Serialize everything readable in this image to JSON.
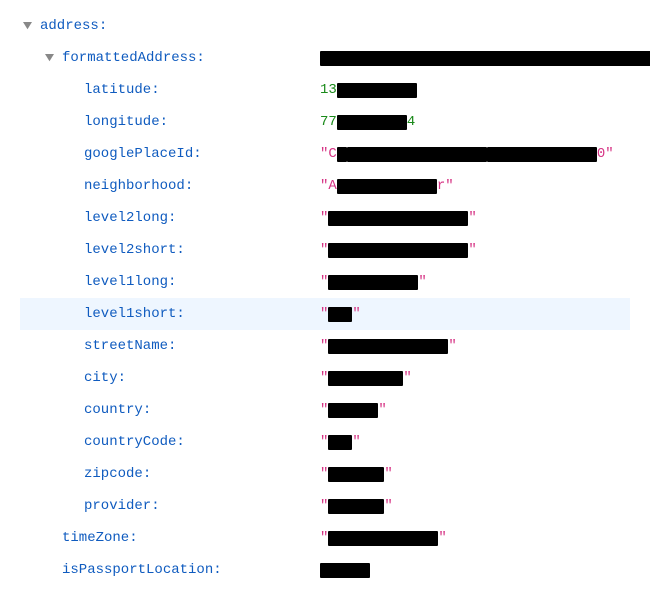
{
  "rows": [
    {
      "indent": 0,
      "toggle": true,
      "key": "address",
      "highlight": false,
      "value": {
        "type": "none"
      }
    },
    {
      "indent": 1,
      "toggle": true,
      "key": "formattedAddress",
      "highlight": false,
      "value": {
        "type": "redacted-plain",
        "parts": [
          {
            "redactW": 340
          }
        ]
      }
    },
    {
      "indent": 2,
      "toggle": false,
      "key": "latitude",
      "highlight": false,
      "value": {
        "type": "number-redacted",
        "parts": [
          {
            "text": "13"
          },
          {
            "redactW": 80
          }
        ]
      }
    },
    {
      "indent": 2,
      "toggle": false,
      "key": "longitude",
      "highlight": false,
      "value": {
        "type": "number-redacted",
        "parts": [
          {
            "text": "77"
          },
          {
            "redactW": 70
          },
          {
            "text": "4"
          }
        ]
      }
    },
    {
      "indent": 2,
      "toggle": false,
      "key": "googlePlaceId",
      "highlight": false,
      "value": {
        "type": "string-redacted",
        "parts": [
          {
            "text": "C"
          },
          {
            "redactW": 10
          },
          {
            "text": ""
          },
          {
            "redactW": 140
          },
          {
            "text": ""
          },
          {
            "redactW": 110
          },
          {
            "text": "0"
          }
        ]
      }
    },
    {
      "indent": 2,
      "toggle": false,
      "key": "neighborhood",
      "highlight": false,
      "value": {
        "type": "string-redacted",
        "parts": [
          {
            "text": "A"
          },
          {
            "redactW": 100
          },
          {
            "text": "r"
          }
        ]
      }
    },
    {
      "indent": 2,
      "toggle": false,
      "key": "level2long",
      "highlight": false,
      "value": {
        "type": "string-redacted",
        "parts": [
          {
            "text": ""
          },
          {
            "redactW": 140
          },
          {
            "text": ""
          }
        ]
      }
    },
    {
      "indent": 2,
      "toggle": false,
      "key": "level2short",
      "highlight": false,
      "value": {
        "type": "string-redacted",
        "parts": [
          {
            "text": ""
          },
          {
            "redactW": 140
          },
          {
            "text": ""
          }
        ]
      }
    },
    {
      "indent": 2,
      "toggle": false,
      "key": "level1long",
      "highlight": false,
      "value": {
        "type": "string-redacted",
        "parts": [
          {
            "text": ""
          },
          {
            "redactW": 90
          },
          {
            "text": ""
          }
        ]
      }
    },
    {
      "indent": 2,
      "toggle": false,
      "key": "level1short",
      "highlight": true,
      "value": {
        "type": "string-redacted",
        "parts": [
          {
            "text": ""
          },
          {
            "redactW": 24
          },
          {
            "text": ""
          }
        ]
      }
    },
    {
      "indent": 2,
      "toggle": false,
      "key": "streetName",
      "highlight": false,
      "value": {
        "type": "string-redacted",
        "parts": [
          {
            "text": ""
          },
          {
            "redactW": 120
          },
          {
            "text": ""
          }
        ]
      }
    },
    {
      "indent": 2,
      "toggle": false,
      "key": "city",
      "highlight": false,
      "value": {
        "type": "string-redacted",
        "parts": [
          {
            "text": ""
          },
          {
            "redactW": 75
          },
          {
            "text": ""
          }
        ]
      }
    },
    {
      "indent": 2,
      "toggle": false,
      "key": "country",
      "highlight": false,
      "value": {
        "type": "string-redacted",
        "parts": [
          {
            "text": ""
          },
          {
            "redactW": 50
          },
          {
            "text": ""
          }
        ]
      }
    },
    {
      "indent": 2,
      "toggle": false,
      "key": "countryCode",
      "highlight": false,
      "value": {
        "type": "string-redacted",
        "parts": [
          {
            "text": ""
          },
          {
            "redactW": 24
          },
          {
            "text": ""
          }
        ]
      }
    },
    {
      "indent": 2,
      "toggle": false,
      "key": "zipcode",
      "highlight": false,
      "value": {
        "type": "string-redacted",
        "parts": [
          {
            "text": ""
          },
          {
            "redactW": 56
          },
          {
            "text": ""
          }
        ]
      }
    },
    {
      "indent": 2,
      "toggle": false,
      "key": "provider",
      "highlight": false,
      "value": {
        "type": "string-redacted",
        "parts": [
          {
            "text": ""
          },
          {
            "redactW": 56
          },
          {
            "text": ""
          }
        ]
      }
    },
    {
      "indent": 1,
      "toggle": false,
      "key": "timeZone",
      "highlight": false,
      "value": {
        "type": "string-redacted",
        "parts": [
          {
            "text": ""
          },
          {
            "redactW": 110
          },
          {
            "text": ""
          }
        ]
      }
    },
    {
      "indent": 1,
      "toggle": false,
      "key": "isPassportLocation",
      "highlight": false,
      "value": {
        "type": "redacted-plain",
        "parts": [
          {
            "redactW": 50
          }
        ]
      }
    }
  ],
  "indentUnit": 22
}
